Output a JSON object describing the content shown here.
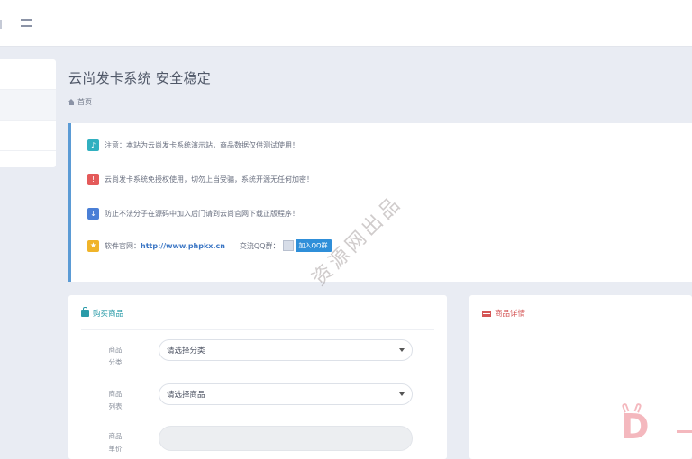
{
  "header": {
    "menu_icon": "menu-icon"
  },
  "page": {
    "title": "云尚发卡系统 安全稳定"
  },
  "breadcrumb": {
    "home_icon": "home-icon",
    "home_label": "首页"
  },
  "notices": [
    {
      "icon": "bell-icon",
      "color": "#31b0c0",
      "text": "注意：本站为云尚发卡系统演示站，商品数据仅供测试使用！"
    },
    {
      "icon": "alert-icon",
      "color": "#e45a5a",
      "text": "云尚发卡系统免授权使用，切勿上当受骗，系统开源无任何加密！"
    },
    {
      "icon": "download-icon",
      "color": "#4a7fd6",
      "text": "防止不法分子在源码中加入后门请到云尚官网下载正版程序！"
    },
    {
      "icon": "star-icon",
      "color": "#f0b429",
      "text_prefix": "软件官网：",
      "link": "http://www.phpkx.cn",
      "qq_label": "交流QQ群：",
      "qq_button": "加入QQ群"
    }
  ],
  "watermark": "资源网出品",
  "buy_panel": {
    "title": "购买商品",
    "icon": "shopping-bag-icon",
    "fields": [
      {
        "label": "商品分类",
        "value": "请选择分类"
      },
      {
        "label": "商品列表",
        "value": "请选择商品"
      },
      {
        "label": "商品单价",
        "value": ""
      }
    ]
  },
  "detail_panel": {
    "title": "商品详情",
    "icon": "flag-icon"
  },
  "colors": {
    "accent": "#5b9bd5",
    "link": "#3a75c4",
    "buy_header": "#2a9ba8",
    "detail_header": "#d45555"
  }
}
